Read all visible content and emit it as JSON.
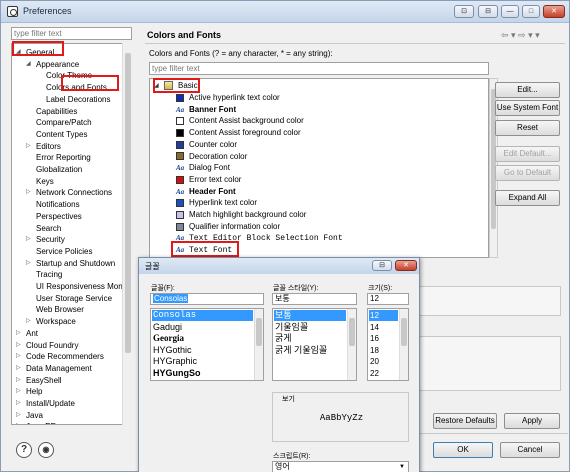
{
  "window": {
    "title": "Preferences"
  },
  "left": {
    "filter_placeholder": "type filter text",
    "tree": [
      {
        "label": "General",
        "indent": 0,
        "arrow": "open"
      },
      {
        "label": "Appearance",
        "indent": 1,
        "arrow": "open"
      },
      {
        "label": "Color Theme",
        "indent": 2,
        "arrow": ""
      },
      {
        "label": "Colors and Fonts",
        "indent": 2,
        "arrow": ""
      },
      {
        "label": "Label Decorations",
        "indent": 2,
        "arrow": ""
      },
      {
        "label": "Capabilities",
        "indent": 1,
        "arrow": ""
      },
      {
        "label": "Compare/Patch",
        "indent": 1,
        "arrow": ""
      },
      {
        "label": "Content Types",
        "indent": 1,
        "arrow": ""
      },
      {
        "label": "Editors",
        "indent": 1,
        "arrow": "closed"
      },
      {
        "label": "Error Reporting",
        "indent": 1,
        "arrow": ""
      },
      {
        "label": "Globalization",
        "indent": 1,
        "arrow": ""
      },
      {
        "label": "Keys",
        "indent": 1,
        "arrow": ""
      },
      {
        "label": "Network Connections",
        "indent": 1,
        "arrow": "closed"
      },
      {
        "label": "Notifications",
        "indent": 1,
        "arrow": ""
      },
      {
        "label": "Perspectives",
        "indent": 1,
        "arrow": ""
      },
      {
        "label": "Search",
        "indent": 1,
        "arrow": ""
      },
      {
        "label": "Security",
        "indent": 1,
        "arrow": "closed"
      },
      {
        "label": "Service Policies",
        "indent": 1,
        "arrow": ""
      },
      {
        "label": "Startup and Shutdown",
        "indent": 1,
        "arrow": "closed"
      },
      {
        "label": "Tracing",
        "indent": 1,
        "arrow": ""
      },
      {
        "label": "UI Responsiveness Mon",
        "indent": 1,
        "arrow": ""
      },
      {
        "label": "User Storage Service",
        "indent": 1,
        "arrow": ""
      },
      {
        "label": "Web Browser",
        "indent": 1,
        "arrow": ""
      },
      {
        "label": "Workspace",
        "indent": 1,
        "arrow": "closed"
      },
      {
        "label": "Ant",
        "indent": 0,
        "arrow": "closed"
      },
      {
        "label": "Cloud Foundry",
        "indent": 0,
        "arrow": "closed"
      },
      {
        "label": "Code Recommenders",
        "indent": 0,
        "arrow": "closed"
      },
      {
        "label": "Data Management",
        "indent": 0,
        "arrow": "closed"
      },
      {
        "label": "EasyShell",
        "indent": 0,
        "arrow": "closed"
      },
      {
        "label": "Help",
        "indent": 0,
        "arrow": "closed"
      },
      {
        "label": "Install/Update",
        "indent": 0,
        "arrow": "closed"
      },
      {
        "label": "Java",
        "indent": 0,
        "arrow": "closed"
      },
      {
        "label": "Java EE",
        "indent": 0,
        "arrow": "closed"
      }
    ]
  },
  "right": {
    "title": "Colors and Fonts",
    "description": "Colors and Fonts (? = any character, * = any string):",
    "filter_placeholder": "type filter text",
    "group": "Basic",
    "items": [
      {
        "label": "Active hyperlink text color",
        "kind": "color",
        "color": "#0b2fb8"
      },
      {
        "label": "Banner Font",
        "kind": "font",
        "bold": true
      },
      {
        "label": "Content Assist background color",
        "kind": "color",
        "color": "#ffffff"
      },
      {
        "label": "Content Assist foreground color",
        "kind": "color",
        "color": "#000000"
      },
      {
        "label": "Counter color",
        "kind": "color",
        "color": "#1c3fa0"
      },
      {
        "label": "Decoration color",
        "kind": "color",
        "color": "#8a6a2a"
      },
      {
        "label": "Dialog Font",
        "kind": "font",
        "bold": false
      },
      {
        "label": "Error text color",
        "kind": "color",
        "color": "#d01010"
      },
      {
        "label": "Header Font",
        "kind": "font",
        "bold": true
      },
      {
        "label": "Hyperlink text color",
        "kind": "color",
        "color": "#1a4fbf"
      },
      {
        "label": "Match highlight background color",
        "kind": "color",
        "color": "#c4c4e8"
      },
      {
        "label": "Qualifier information color",
        "kind": "color",
        "color": "#7a8a9a"
      },
      {
        "label": "Text Editor Block Selection Font",
        "kind": "font",
        "mono": true
      },
      {
        "label": "Text Font",
        "kind": "font",
        "mono": true
      }
    ],
    "buttons": {
      "edit": "Edit...",
      "use_system_font": "Use System Font",
      "reset": "Reset",
      "edit_default": "Edit Default...",
      "go_to_default": "Go to Default",
      "expand_all": "Expand All",
      "restore_defaults": "Restore Defaults",
      "apply": "Apply",
      "ok": "OK",
      "cancel": "Cancel"
    }
  },
  "font_dialog": {
    "title": "글꼴",
    "font_label": "글꼴(F):",
    "font_value": "Consolas",
    "fonts": [
      "Consolas",
      "Gadugi",
      "Georgia",
      "HYGothic",
      "HYGraphic",
      "HYGungSo"
    ],
    "style_label": "글꼴 스타일(Y):",
    "style_value": "보통",
    "styles": [
      "보통",
      "기울임꼴",
      "굵게",
      "굵게 기울임꼴"
    ],
    "size_label": "크기(S):",
    "size_value": "12",
    "sizes": [
      "12",
      "14",
      "16",
      "18",
      "20",
      "22",
      "24"
    ],
    "preview_label": "보기",
    "preview_text": "AaBbYyZz",
    "script_label": "스크립트(R):",
    "script_value": "영어"
  },
  "colors": {
    "highlight": "#e01919",
    "selection": "#3399ff"
  }
}
